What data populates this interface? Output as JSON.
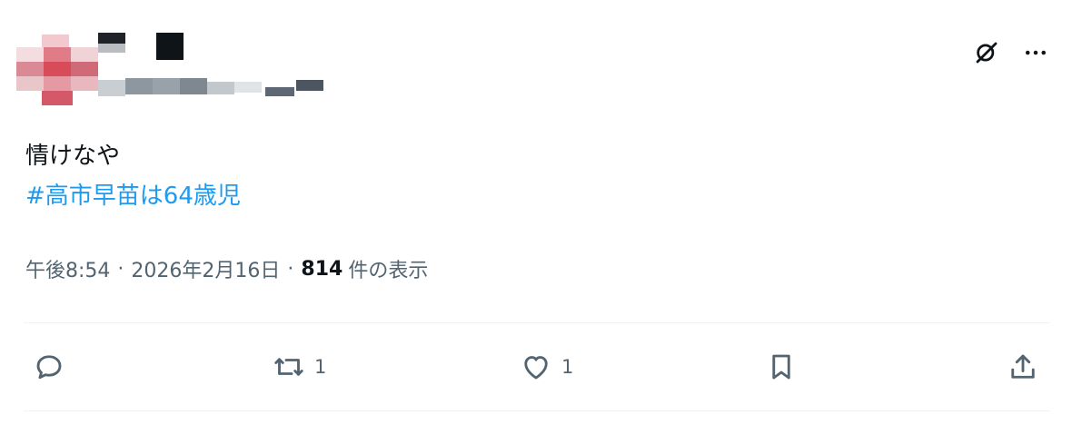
{
  "tweet": {
    "text": "情けなや",
    "hashtag": "#高市早苗は64歳児"
  },
  "meta": {
    "time": "午後8:54",
    "separator": "·",
    "date": "2026年2月16日",
    "views_count": "814",
    "views_label": "件の表示"
  },
  "actions": {
    "reply_count": "",
    "retweet_count": "1",
    "like_count": "1"
  },
  "icons": {
    "top": [
      "grok-icon",
      "more-icon"
    ],
    "bar": [
      "reply-icon",
      "retweet-icon",
      "like-icon",
      "bookmark-icon",
      "share-icon"
    ]
  },
  "colors": {
    "hashtag": "#1d9bf0",
    "secondary_text": "#536471",
    "primary_text": "#0f1419",
    "divider": "#eff3f4"
  }
}
